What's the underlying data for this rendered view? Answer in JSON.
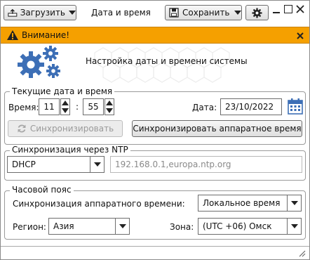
{
  "toolbar": {
    "load_label": "Загрузить",
    "title": "Дата и время",
    "save_label": "Сохранить"
  },
  "alert": {
    "text": "Внимание!",
    "color": "#f5a000"
  },
  "header": {
    "text": "Настройка даты и времени системы"
  },
  "datetime": {
    "legend": "Текущие дата и время",
    "time_label": "Время:",
    "hours": "11",
    "separator": ":",
    "minutes": "55",
    "date_label": "Дата:",
    "date": "23/10/2022",
    "sync_label": "Синхронизировать",
    "sync_hw_label": "Синхронизировать аппаратное время"
  },
  "ntp": {
    "legend": "Синхронизация через NTP",
    "mode": "DHCP",
    "servers": "192.168.0.1,europa.ntp.org"
  },
  "timezone": {
    "legend": "Часовой пояс",
    "hw_sync_label": "Синхронизация аппаратного времени:",
    "hw_sync_value": "Локальное время",
    "region_label": "Регион:",
    "region_value": "Азия",
    "zone_label": "Зона:",
    "zone_value": "(UTC +06) Омск"
  },
  "icons": {
    "accent": "#3d6fb6"
  }
}
